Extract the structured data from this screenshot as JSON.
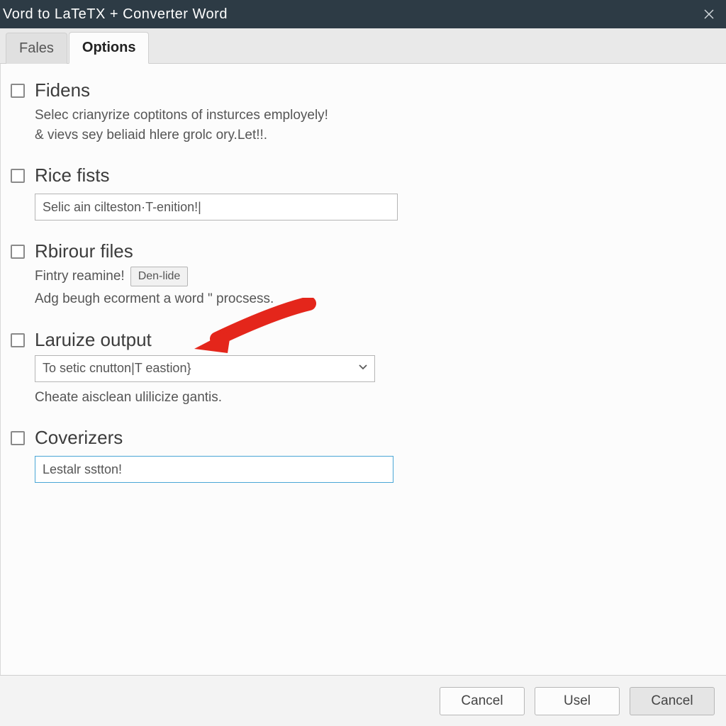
{
  "window": {
    "title": "Vord to LaTeTX + Converter Word"
  },
  "tabs": {
    "files": "Fales",
    "options": "Options",
    "active": "options"
  },
  "sections": {
    "fidens": {
      "title": "Fidens",
      "desc": "Selec crianyrize coptitons of insturces employely!\n& vievs sey beliaid hlere grolc ory.Let!!."
    },
    "rice_fists": {
      "title": "Rice fists",
      "input_value": "Selic ain cilteston·T-enition!|"
    },
    "rbirour": {
      "title": "Rbirour files",
      "inline_label": "Fintry reamine!",
      "button_label": "Den-lide",
      "desc": "Adg beugh ecorment a word \" procsess."
    },
    "laruize": {
      "title": "Laruize output",
      "select_value": "To setic cnutton|T eastion}",
      "desc": "Cheate aisclean ulilicize gantis."
    },
    "coverizers": {
      "title": "Coverizers",
      "input_value": "Lestalr sstton!"
    }
  },
  "footer": {
    "cancel1": "Cancel",
    "use": "Usel",
    "cancel2": "Cancel"
  }
}
